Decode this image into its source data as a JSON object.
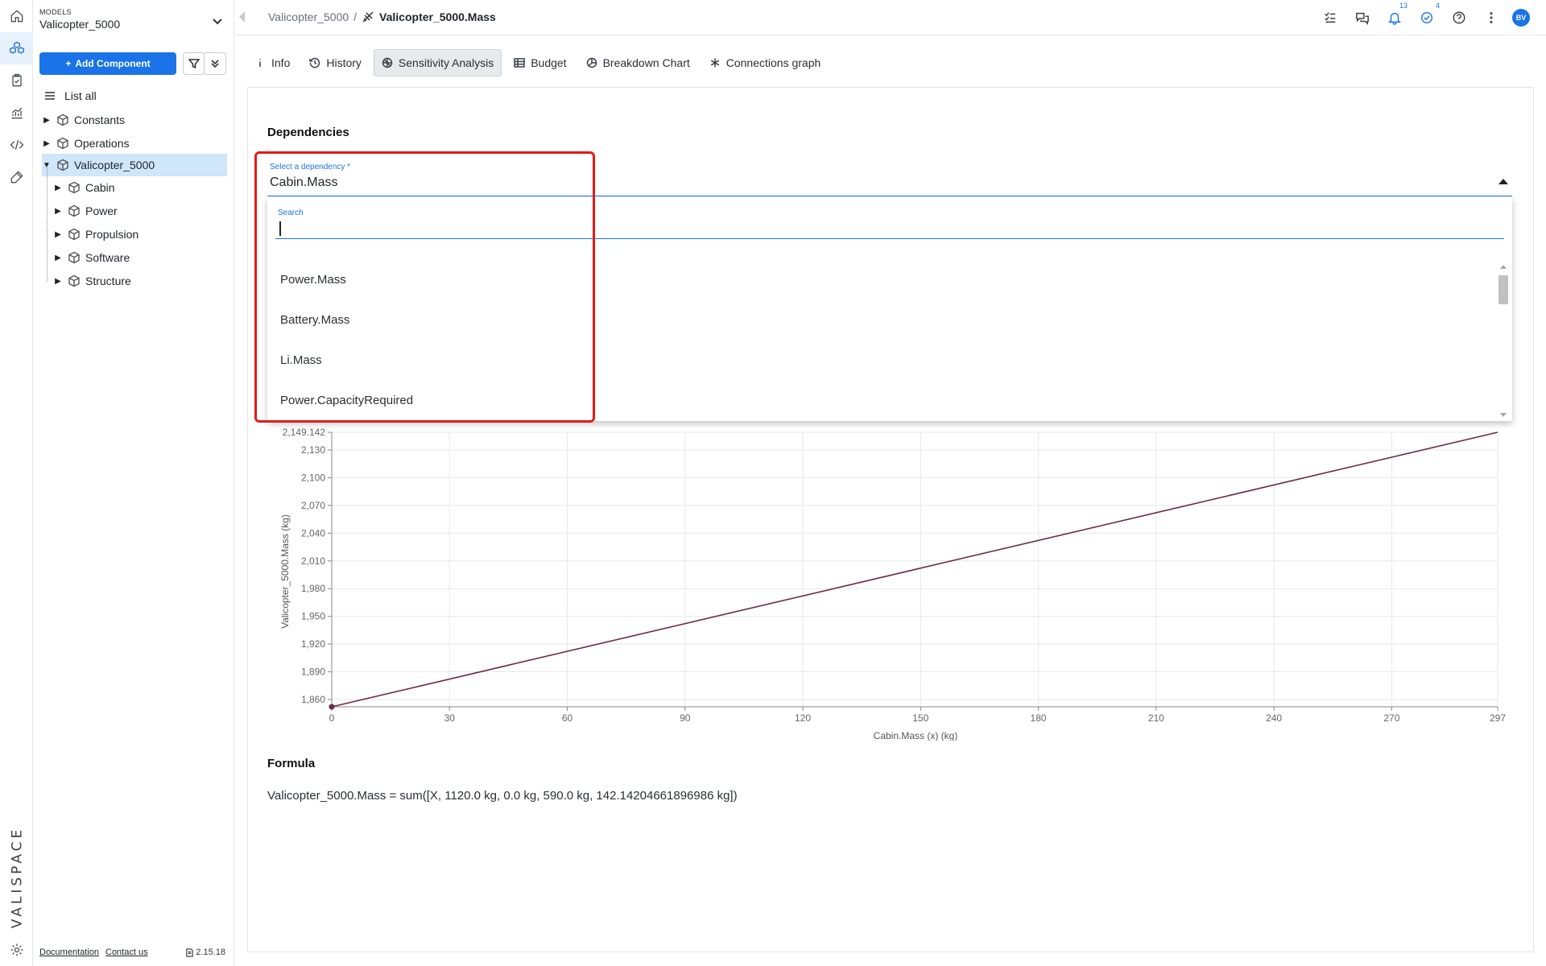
{
  "rail": {
    "items": [
      {
        "name": "home-icon"
      },
      {
        "name": "models-icon",
        "active": true
      },
      {
        "name": "requirements-icon"
      },
      {
        "name": "analytics-icon"
      },
      {
        "name": "code-icon"
      },
      {
        "name": "tools-icon"
      }
    ],
    "logo": "VALISPACE",
    "settings_icon": "gear-icon"
  },
  "sidebar": {
    "caption": "MODELS",
    "model": "Valicopter_5000",
    "add_button": "Add Component",
    "tree": [
      {
        "label": "List all",
        "level": 0,
        "icon": "list-icon"
      },
      {
        "label": "Constants",
        "level": 0,
        "expanded": false
      },
      {
        "label": "Operations",
        "level": 0,
        "expanded": false
      },
      {
        "label": "Valicopter_5000",
        "level": 0,
        "expanded": true,
        "selected": true
      },
      {
        "label": "Cabin",
        "level": 1,
        "expanded": false
      },
      {
        "label": "Power",
        "level": 1,
        "expanded": false
      },
      {
        "label": "Propulsion",
        "level": 1,
        "expanded": false
      },
      {
        "label": "Software",
        "level": 1,
        "expanded": false
      },
      {
        "label": "Structure",
        "level": 1,
        "expanded": false
      }
    ],
    "footer": {
      "documentation": "Documentation",
      "contact": "Contact us",
      "version": "2.15.18"
    }
  },
  "topbar": {
    "breadcrumb_parent": "Valicopter_5000",
    "separator": "/",
    "breadcrumb_current": "Valicopter_5000.Mass",
    "notifications_count": "13",
    "tasks_count": "4",
    "avatar": "BV"
  },
  "tabs": [
    {
      "label": "Info",
      "icon": "info-icon"
    },
    {
      "label": "History",
      "icon": "history-icon"
    },
    {
      "label": "Sensitivity Analysis",
      "icon": "sensitivity-icon",
      "active": true
    },
    {
      "label": "Budget",
      "icon": "table-icon"
    },
    {
      "label": "Breakdown Chart",
      "icon": "pie-icon"
    },
    {
      "label": "Connections graph",
      "icon": "asterisk-icon"
    }
  ],
  "dependencies": {
    "title": "Dependencies",
    "select_label": "Select a dependency *",
    "selected": "Cabin.Mass",
    "search_label": "Search",
    "search_value": "",
    "options": [
      "Power.Mass",
      "Battery.Mass",
      "Li.Mass",
      "Power.CapacityRequired"
    ]
  },
  "chart_data": {
    "type": "line",
    "xlabel": "Cabin.Mass (x) (kg)",
    "ylabel": "Valicopter_5000.Mass (kg)",
    "x_ticks": [
      "0",
      "30",
      "60",
      "90",
      "120",
      "150",
      "180",
      "210",
      "240",
      "270",
      "297"
    ],
    "y_ticks": [
      "1,860",
      "1,890",
      "1,920",
      "1,950",
      "1,980",
      "2,010",
      "2,040",
      "2,070",
      "2,100",
      "2,130",
      "2,149.142"
    ],
    "xlim": [
      0,
      297
    ],
    "ylim": [
      1852.142,
      2149.142
    ],
    "series": [
      {
        "x": [
          0,
          297
        ],
        "y": [
          1852.142,
          2149.142
        ],
        "color": "#6b2d3f"
      }
    ],
    "grid": true
  },
  "formula": {
    "title": "Formula",
    "text": "Valicopter_5000.Mass = sum([X, 1120.0 kg, 0.0 kg, 590.0 kg, 142.14204661896986 kg])"
  },
  "colors": {
    "accent": "#1a73e8",
    "highlight": "#e31b1b",
    "selected_row": "#cfe6fb"
  }
}
